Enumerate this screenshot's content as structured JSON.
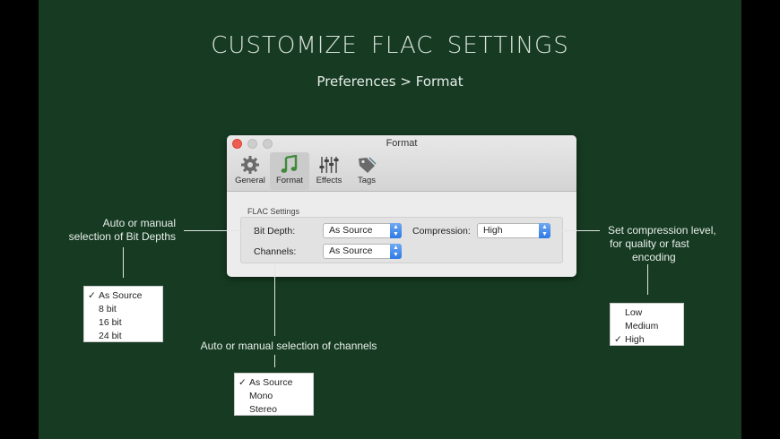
{
  "headline": "CUSTOMIZE FLAC SETTINGS",
  "subheadline": "Preferences > Format",
  "window": {
    "title": "Format",
    "tabs": [
      {
        "label": "General",
        "icon": "gear-icon"
      },
      {
        "label": "Format",
        "icon": "music-note-icon",
        "selected": true
      },
      {
        "label": "Effects",
        "icon": "equalizer-sliders-icon"
      },
      {
        "label": "Tags",
        "icon": "tag-icon"
      }
    ],
    "section_label": "FLAC Settings",
    "bit_depth": {
      "label": "Bit Depth:",
      "value": "As Source"
    },
    "channels": {
      "label": "Channels:",
      "value": "As Source"
    },
    "compression": {
      "label": "Compression:",
      "value": "High"
    }
  },
  "annotations": {
    "bit_depth_note_line1": "Auto or manual",
    "bit_depth_note_line2": "selection of Bit Depths",
    "channels_note": "Auto or manual selection of channels",
    "compression_note_line1": "Set compression level,",
    "compression_note_line2": "for quality or fast",
    "compression_note_line3": "encoding"
  },
  "menus": {
    "check": "✓",
    "bit_depth_options": [
      "As Source",
      "8 bit",
      "16 bit",
      "24 bit"
    ],
    "bit_depth_selected": 0,
    "channel_options": [
      "As Source",
      "Mono",
      "Stereo"
    ],
    "channel_selected": 0,
    "compression_options": [
      "Low",
      "Medium",
      "High"
    ],
    "compression_selected": 2
  },
  "colors": {
    "background": "#163b22",
    "selected_popup_arrow": "#2d79e4",
    "close_button": "#ee5b51"
  }
}
